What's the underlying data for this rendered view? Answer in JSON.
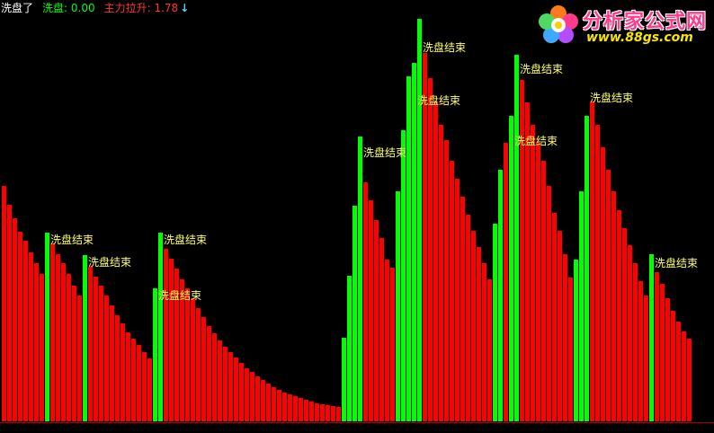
{
  "header": {
    "title": "洗盘了",
    "wash_label": "洗盘: 0.00",
    "main_label": "主力拉升: 1.78",
    "arrow": "↓"
  },
  "colors": {
    "up": "#ff0000",
    "wash": "#00ff00",
    "label": "#ffff66",
    "header_title": "#ffffff",
    "header_wash": "#00ff00",
    "header_main": "#ff3333",
    "header_arrow": "#66ccff",
    "axis": "#aa0000"
  },
  "logo": {
    "name": "分析家公式网",
    "url": "www.88gs.com"
  },
  "chart_data": {
    "type": "bar",
    "ylim": [
      0,
      460
    ],
    "series": [
      {
        "values": [
          262,
          241,
          226,
          211,
          201,
          188,
          176,
          164,
          210,
          198,
          186,
          176,
          164,
          151,
          140,
          185,
          172,
          161,
          151,
          140,
          129,
          118,
          109,
          99,
          92,
          85,
          77,
          70,
          148,
          210,
          192,
          181,
          170,
          158,
          148,
          137,
          126,
          116,
          106,
          98,
          90,
          83,
          77,
          71,
          65,
          59,
          55,
          50,
          46,
          42,
          38,
          35,
          32,
          30,
          28,
          26,
          24,
          22,
          20,
          19,
          18,
          17,
          16,
          93,
          162,
          240,
          317,
          266,
          246,
          224,
          204,
          180,
          171,
          256,
          324,
          384,
          399,
          448,
          410,
          382,
          356,
          330,
          313,
          290,
          270,
          250,
          230,
          212,
          194,
          176,
          158,
          220,
          280,
          310,
          340,
          408,
          380,
          355,
          330,
          310,
          290,
          262,
          232,
          212,
          186,
          160,
          180,
          256,
          340,
          356,
          330,
          305,
          280,
          256,
          235,
          215,
          196,
          176,
          156,
          140,
          186,
          166,
          153,
          137,
          123,
          111,
          100,
          92
        ],
        "colors": [
          "r",
          "r",
          "r",
          "r",
          "r",
          "r",
          "r",
          "r",
          "g",
          "r",
          "r",
          "r",
          "r",
          "r",
          "r",
          "g",
          "r",
          "r",
          "r",
          "r",
          "r",
          "r",
          "r",
          "r",
          "r",
          "r",
          "r",
          "r",
          "g",
          "g",
          "r",
          "r",
          "r",
          "r",
          "r",
          "r",
          "r",
          "r",
          "r",
          "r",
          "r",
          "r",
          "r",
          "r",
          "r",
          "r",
          "r",
          "r",
          "r",
          "r",
          "r",
          "r",
          "r",
          "r",
          "r",
          "r",
          "r",
          "r",
          "r",
          "r",
          "r",
          "r",
          "r",
          "g",
          "g",
          "g",
          "g",
          "r",
          "r",
          "r",
          "r",
          "r",
          "r",
          "g",
          "g",
          "g",
          "g",
          "g",
          "r",
          "r",
          "r",
          "r",
          "r",
          "r",
          "r",
          "r",
          "r",
          "r",
          "r",
          "r",
          "r",
          "g",
          "g",
          "r",
          "g",
          "g",
          "r",
          "r",
          "r",
          "r",
          "r",
          "r",
          "r",
          "r",
          "r",
          "r",
          "g",
          "g",
          "g",
          "r",
          "r",
          "r",
          "r",
          "r",
          "r",
          "r",
          "r",
          "r",
          "r",
          "r",
          "g",
          "r",
          "r",
          "r",
          "r",
          "r",
          "r",
          "r"
        ]
      }
    ],
    "annotations": [
      {
        "index": 8,
        "y": 210,
        "text": "洗盘结束"
      },
      {
        "index": 15,
        "y": 185,
        "text": "洗盘结束"
      },
      {
        "index": 28,
        "y": 148,
        "text": "洗盘结束"
      },
      {
        "index": 29,
        "y": 210,
        "text": "洗盘结束"
      },
      {
        "index": 66,
        "y": 307,
        "text": "洗盘结束"
      },
      {
        "index": 77,
        "y": 424,
        "text": "洗盘结束"
      },
      {
        "index": 76,
        "y": 365,
        "text": "洗盘结束"
      },
      {
        "index": 94,
        "y": 320,
        "text": "洗盘结束"
      },
      {
        "index": 95,
        "y": 400,
        "text": "洗盘结束"
      },
      {
        "index": 108,
        "y": 368,
        "text": "洗盘结束"
      },
      {
        "index": 120,
        "y": 184,
        "text": "洗盘结束"
      }
    ]
  }
}
